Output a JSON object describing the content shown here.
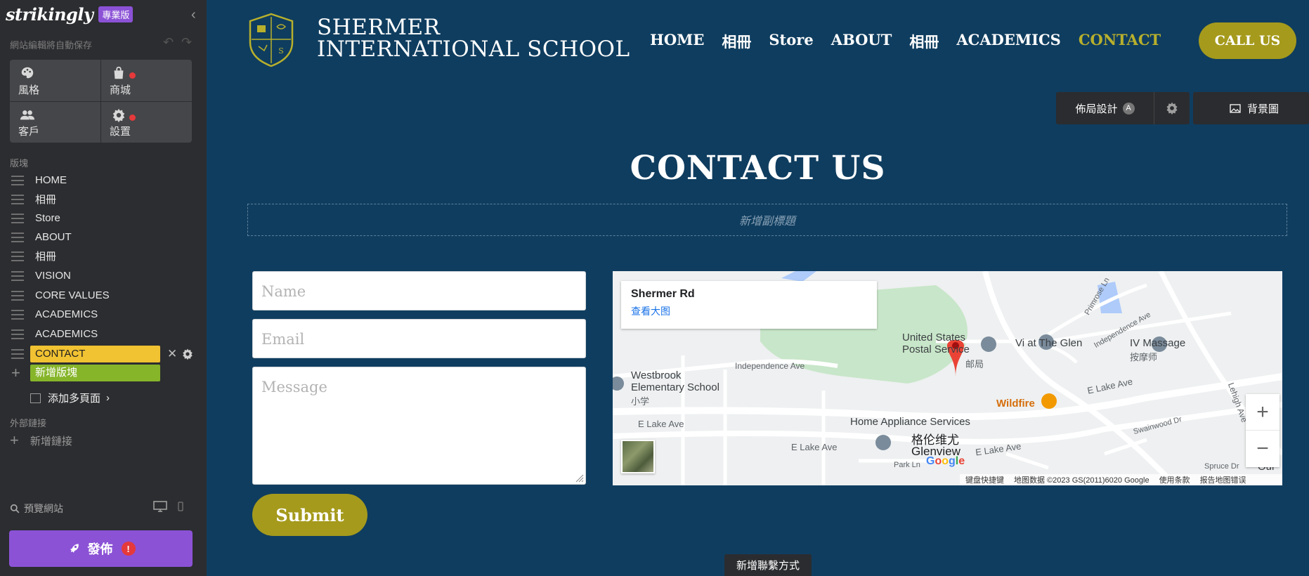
{
  "editor": {
    "logo": "strikingly",
    "pro_badge": "專業版",
    "autosave_text": "網站編輯將自動保存",
    "tiles": [
      {
        "label": "風格",
        "icon": "palette-icon"
      },
      {
        "label": "商城",
        "icon": "shopping-bag-icon"
      },
      {
        "label": "客戶",
        "icon": "people-icon"
      },
      {
        "label": "設置",
        "icon": "gear-icon"
      }
    ],
    "sections_heading": "版塊",
    "sections": [
      {
        "label": "HOME"
      },
      {
        "label": "相冊"
      },
      {
        "label": "Store"
      },
      {
        "label": "ABOUT"
      },
      {
        "label": "相冊"
      },
      {
        "label": "VISION"
      },
      {
        "label": "CORE VALUES"
      },
      {
        "label": "ACADEMICS"
      },
      {
        "label": "ACADEMICS"
      },
      {
        "label": "CONTACT"
      }
    ],
    "add_section_label": "新增版塊",
    "add_multi_page_label": "添加多頁面",
    "external_links_heading": "外部鏈接",
    "add_link_label": "新增鏈接",
    "preview_label": "預覽網站",
    "publish_label": "發佈",
    "publish_alert": "!"
  },
  "site": {
    "school_name_line1": "SHERMER",
    "school_name_line2": "INTERNATIONAL SCHOOL",
    "nav": [
      "HOME",
      "相冊",
      "Store",
      "ABOUT",
      "相冊",
      "ACADEMICS",
      "CONTACT"
    ],
    "call_button": "CALL US",
    "layout_button": "佈局設計",
    "layout_badge": "A",
    "background_button": "背景圖",
    "contact_title": "CONTACT US",
    "subtitle_placeholder": "新增副標題",
    "form": {
      "name_placeholder": "Name",
      "email_placeholder": "Email",
      "message_placeholder": "Message",
      "submit_label": "Submit"
    },
    "map": {
      "place_title": "Shermer Rd",
      "view_larger": "查看大图",
      "labels": {
        "usps1": "United States",
        "usps2": "Postal Service",
        "usps_cn": "邮局",
        "vi": "Vi at The Glen",
        "iv": "IV Massage",
        "iv_cn": "按摩师",
        "westbrook1": "Westbrook",
        "westbrook2": "Elementary School",
        "westbrook_cn": "小学",
        "independence": "Independence Ave",
        "independence2": "Independence Ave",
        "elake1": "E Lake Ave",
        "elake2": "E Lake Ave",
        "elake3": "E Lake Ave",
        "elake4": "E Lake Ave",
        "wildfire": "Wildfire",
        "home_appliance": "Home Appliance Services",
        "glenview_cn": "格伦维尤",
        "glenview": "Glenview",
        "swainwood": "Swainwood Dr",
        "primrose": "Primrose Ln",
        "lehigh": "Lehigh Ave",
        "parkln": "Park Ln",
        "spruce": "Spruce Dr",
        "our": "Our"
      },
      "footer": [
        "键盘快捷键",
        "地图数据 ©2023 GS(2011)6020 Google",
        "使用条款",
        "报告地图错误"
      ],
      "google": "Google"
    },
    "add_contact": "新增聯繫方式"
  },
  "colors": {
    "site_bg": "#0f3d5f",
    "accent_gold": "#a59a1c",
    "nav_active": "#b8b02c",
    "sidebar_bg": "#2c2d30",
    "publish_purple": "#8b52d6",
    "section_active": "#f1c232",
    "add_section_green": "#86b52a"
  }
}
